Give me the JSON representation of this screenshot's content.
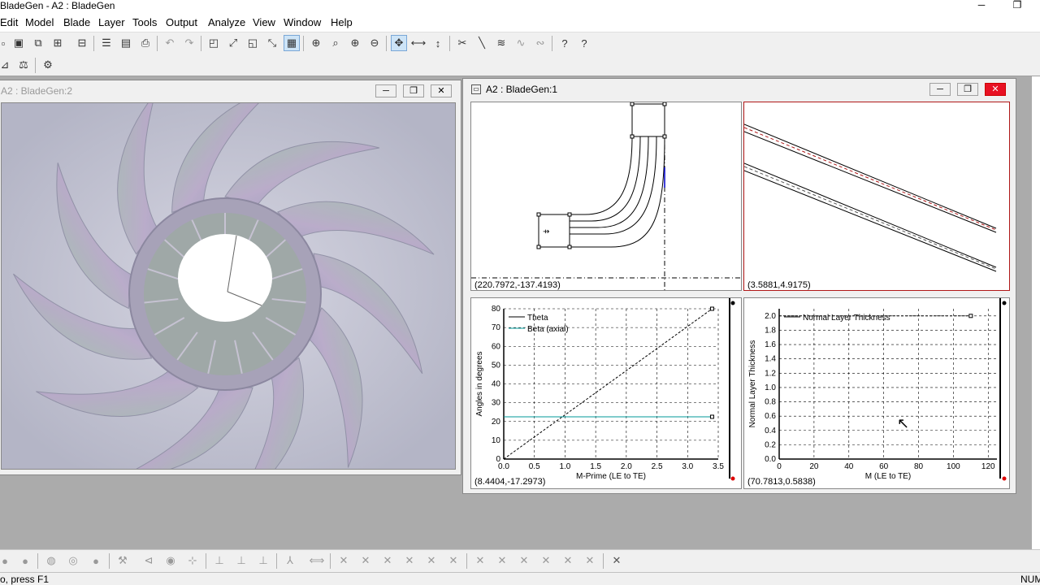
{
  "app": {
    "title": "BladeGen - A2 : BladeGen",
    "window_min": "─",
    "window_max": "❐"
  },
  "menu": [
    "Edit",
    "Model",
    "Blade",
    "Layer",
    "Tools",
    "Output",
    "Analyze",
    "View",
    "Window",
    "Help"
  ],
  "left_window": {
    "title": "A2 : BladeGen:2",
    "min": "─",
    "max": "❐",
    "close": "✕"
  },
  "right_window": {
    "title": "A2 : BladeGen:1",
    "min": "─",
    "max": "❐",
    "close": "✕"
  },
  "panes": {
    "meridional": {
      "coord": "(220.7972,-137.4193)"
    },
    "layer": {
      "coord": "(3.5881,4.9175)"
    },
    "angles": {
      "coord": "(8.4404,-17.2973)"
    },
    "thickness": {
      "coord": "(70.7813,0.5838)"
    }
  },
  "chart_data": [
    {
      "type": "line",
      "xlabel": "M-Prime (LE to TE)",
      "ylabel": "Angles in degrees",
      "xlim": [
        0,
        3.5
      ],
      "ylim": [
        0,
        80
      ],
      "x_ticks": [
        "0.0",
        "0.5",
        "1.0",
        "1.5",
        "2.0",
        "2.5",
        "3.0",
        "3.5"
      ],
      "y_ticks": [
        "0",
        "10",
        "20",
        "30",
        "40",
        "50",
        "60",
        "70",
        "80"
      ],
      "series": [
        {
          "name": "Theta",
          "x": [
            0,
            3.4
          ],
          "y": [
            0,
            80
          ],
          "color": "#000000",
          "style": "dashed"
        },
        {
          "name": "Beta (axial)",
          "x": [
            0,
            3.4
          ],
          "y": [
            22.5,
            22.5
          ],
          "color": "#009999",
          "style": "solid"
        }
      ],
      "grid": true,
      "legend": "top-left"
    },
    {
      "type": "line",
      "xlabel": "M (LE to TE)",
      "ylabel": "Normal Layer Thickness",
      "xlim": [
        0,
        125
      ],
      "ylim": [
        0,
        2.1
      ],
      "x_ticks": [
        "0",
        "20",
        "40",
        "60",
        "80",
        "100",
        "120"
      ],
      "y_ticks": [
        "0.0",
        "0.2",
        "0.4",
        "0.6",
        "0.8",
        "1.0",
        "1.2",
        "1.4",
        "1.6",
        "1.8",
        "2.0"
      ],
      "series": [
        {
          "name": "Normal Layer Thickness",
          "x": [
            0,
            110
          ],
          "y": [
            2.0,
            2.0
          ],
          "color": "#000000",
          "style": "dashed"
        }
      ],
      "grid": true,
      "legend": "top-left"
    }
  ],
  "status": {
    "left": "o, press F1",
    "right": "NUM"
  }
}
